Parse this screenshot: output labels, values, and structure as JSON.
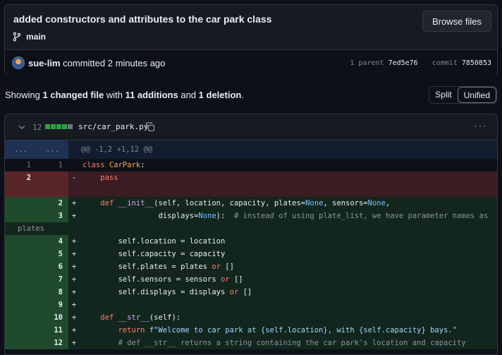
{
  "commit": {
    "title": "added constructors and attributes to the car park class",
    "branch": "main",
    "browse_label": "Browse files",
    "author": "sue-lim",
    "action": "committed",
    "time_ago": "2 minutes ago",
    "parent_label": "1 parent",
    "parent_hash": "7ed5e76",
    "commit_label": "commit",
    "commit_hash": "7850853"
  },
  "summary": {
    "prefix": "Showing",
    "changed": "1 changed file",
    "with": "with",
    "additions": "11 additions",
    "and": "and",
    "deletions": "1 deletion",
    "suffix": "."
  },
  "view": {
    "split_label": "Split",
    "unified_label": "Unified"
  },
  "file": {
    "change_count": "12",
    "path": "src/car_park.py",
    "more_label": "···",
    "hunk": {
      "left": "...",
      "right": "...",
      "header": "@@ -1,2 +1,12 @@"
    }
  },
  "colors": {
    "added_bg": "#12261e",
    "deleted_bg": "#3a1c22",
    "keyword": "#ff7b72",
    "function": "#d2a8ff",
    "class": "#ffa657",
    "constant": "#79c0ff",
    "string": "#a5d6ff"
  },
  "lines": {
    "l1": {
      "old": "1",
      "new": "1",
      "kw": "class",
      "name": "CarPark",
      "rest": ":"
    },
    "l2": {
      "old": "2",
      "mark": "-",
      "text": "    pass"
    },
    "l3": {
      "new": "2",
      "mark": "+",
      "a": "    ",
      "kw": "def",
      "sp": " ",
      "fn": "__init__",
      "b": "(self, location, capacity, plates=",
      "c1": "None",
      "b2": ", sensors=",
      "c2": "None",
      "b3": ","
    },
    "l4": {
      "new": "3",
      "mark": "+",
      "a": "                 displays=",
      "c1": "None",
      "b": "):  ",
      "cm": "# instead of using plate_list, we have parameter names as"
    },
    "l4w": {
      "cm": "plates"
    },
    "l5": {
      "new": "4",
      "mark": "+",
      "text": "        self.location = location"
    },
    "l6": {
      "new": "5",
      "mark": "+",
      "text": "        self.capacity = capacity"
    },
    "l7": {
      "new": "6",
      "mark": "+",
      "a": "        self.plates = plates ",
      "kw": "or",
      "b": " []"
    },
    "l8": {
      "new": "7",
      "mark": "+",
      "a": "        self.sensors = sensors ",
      "kw": "or",
      "b": " []"
    },
    "l9": {
      "new": "8",
      "mark": "+",
      "a": "        self.displays = displays ",
      "kw": "or",
      "b": " []"
    },
    "l10": {
      "new": "9",
      "mark": "+",
      "text": ""
    },
    "l11": {
      "new": "10",
      "mark": "+",
      "a": "    ",
      "kw": "def",
      "sp": " ",
      "fn": "__str__",
      "b": "(self):"
    },
    "l12": {
      "new": "11",
      "mark": "+",
      "a": "        ",
      "kw": "return",
      "sp": " ",
      "str": "f\"Welcome to car park at {self.location}, with {self.capacity} bays.\""
    },
    "l13": {
      "new": "12",
      "mark": "+",
      "cm": "        # def __str__ returns a string containing the car park's location and capacity"
    }
  }
}
